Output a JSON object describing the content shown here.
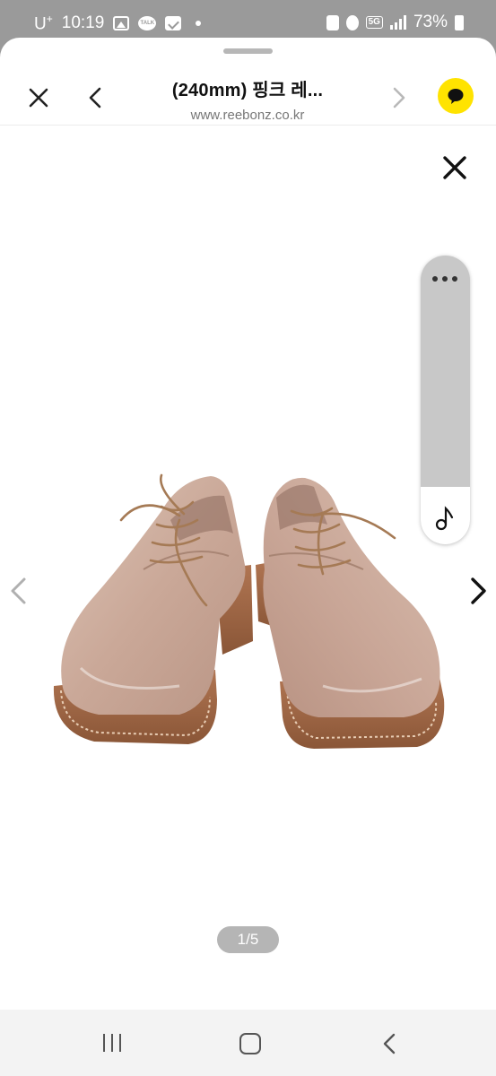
{
  "status_bar": {
    "carrier": "U",
    "carrier_sup": "+",
    "time": "10:19",
    "network": "5G",
    "battery": "73%"
  },
  "header": {
    "title": "(240mm) 핑크 레...",
    "url": "www.reebonz.co.kr"
  },
  "viewer": {
    "page_indicator": "1/5",
    "current_page": 1,
    "total_pages": 5
  },
  "icons": {
    "close": "close-icon",
    "back": "chevron-left-icon",
    "forward": "chevron-right-icon",
    "kakao": "chat-bubble-icon",
    "more": "more-horizontal-icon",
    "music": "music-note-icon"
  },
  "colors": {
    "kakao_yellow": "#ffe300",
    "status_bar_bg": "#9a9a9a",
    "indicator_bg": "#b5b5b5"
  }
}
